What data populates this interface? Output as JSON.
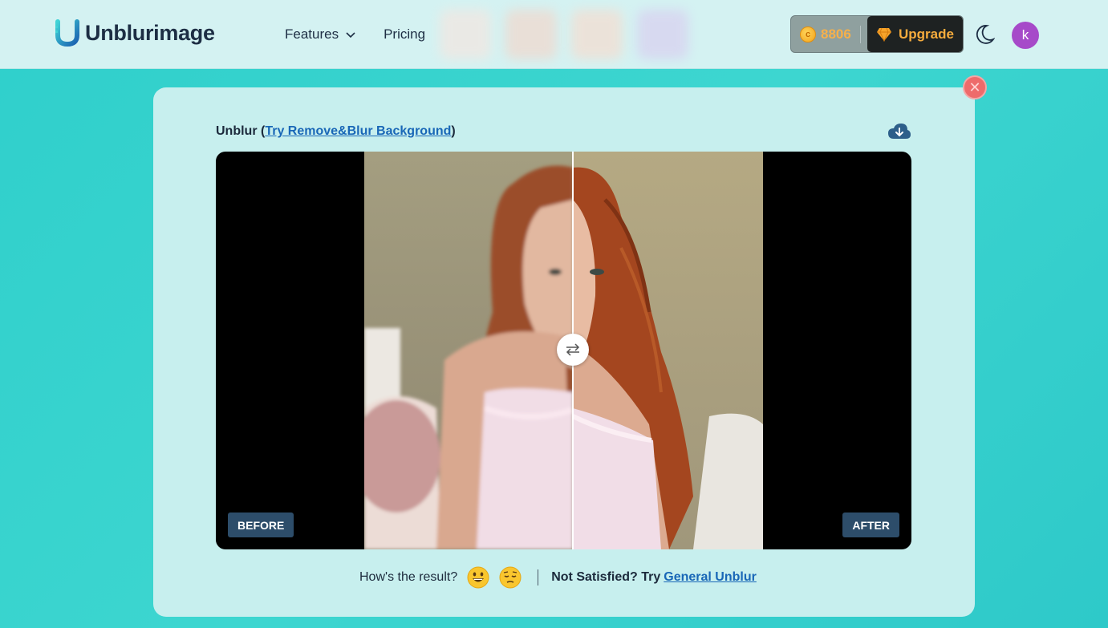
{
  "header": {
    "logo_text": "Unblurimage",
    "nav": [
      {
        "label": "Features",
        "has_dropdown": true
      },
      {
        "label": "Pricing",
        "has_dropdown": false
      }
    ],
    "credits": "8806",
    "upgrade_label": "Upgrade",
    "avatar_letter": "k"
  },
  "panel": {
    "title_prefix": "Unblur (",
    "title_link": "Try Remove&Blur Background",
    "title_suffix": ")",
    "before_label": "BEFORE",
    "after_label": "AFTER",
    "feedback_question": "How's the result?",
    "not_satisfied": "Not Satisfied? Try",
    "general_unblur_link": "General Unblur"
  },
  "colors": {
    "accent": "#3dd6d0",
    "header_bg": "#d4f2f2",
    "panel_bg": "#c7efee",
    "link": "#1967b7",
    "upgrade_text": "#f6ac3d",
    "avatar": "#a64ac9",
    "close": "#ee6b6b",
    "tag": "#2d4d6a"
  }
}
